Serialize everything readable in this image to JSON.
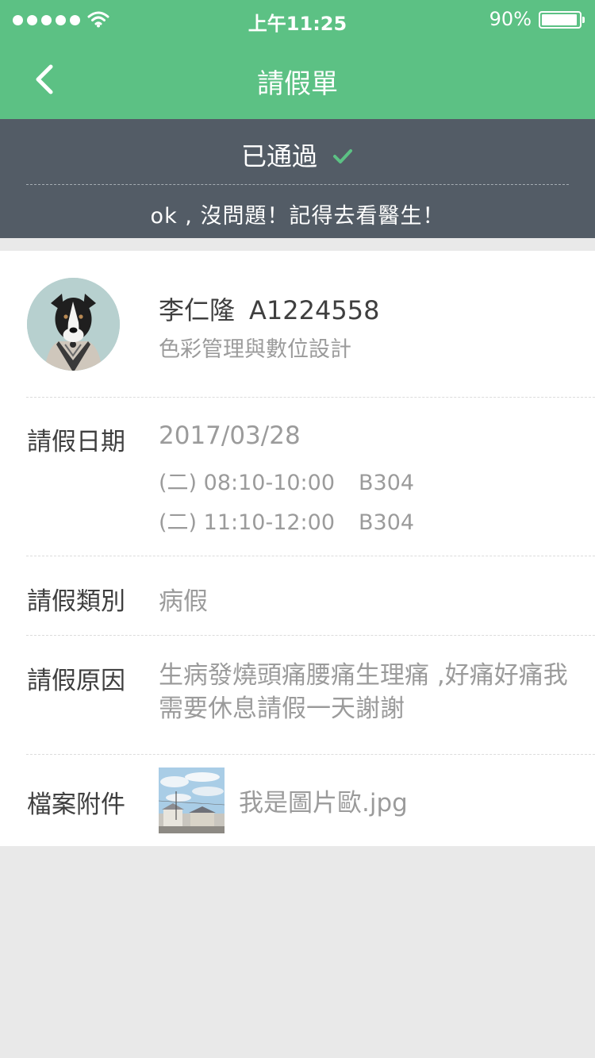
{
  "status_bar": {
    "time": "上午11:25",
    "battery": "90%",
    "battery_level": 0.9
  },
  "nav": {
    "title": "請假單"
  },
  "approval": {
    "status": "已通過",
    "message": "ok , 沒問題！記得去看醫生！"
  },
  "student": {
    "name": "李仁隆",
    "id": "A1224558",
    "department": "色彩管理與數位設計"
  },
  "leave_date": {
    "label": "請假日期",
    "date": "2017/03/28",
    "sessions": [
      {
        "time": "(二) 08:10-10:00",
        "room": "B304"
      },
      {
        "time": "(二) 11:10-12:00",
        "room": "B304"
      }
    ]
  },
  "leave_type": {
    "label": "請假類別",
    "value": "病假"
  },
  "leave_reason": {
    "label": "請假原因",
    "value": "生病發燒頭痛腰痛生理痛 ,好痛好痛我需要休息請假一天謝謝"
  },
  "attachment": {
    "label": "檔案附件",
    "filename": "我是圖片歐.jpg"
  },
  "colors": {
    "primary_green": "#5cc184",
    "status_bg": "#535c66",
    "check_green": "#5cc184",
    "page_bg": "#e9e9e9"
  }
}
